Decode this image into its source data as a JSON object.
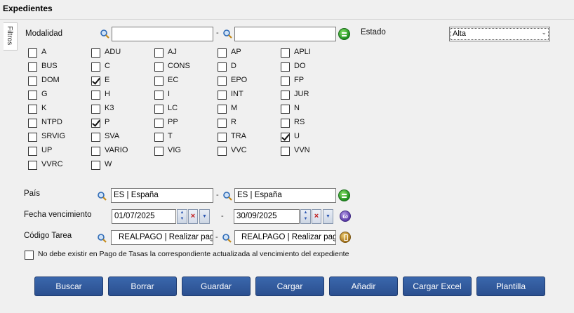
{
  "window": {
    "title": "Expedientes"
  },
  "sidebar": {
    "tab_label": "Filtros"
  },
  "filters": {
    "modalidad": {
      "label": "Modalidad",
      "from": "",
      "to": "",
      "separator": "-"
    },
    "estado": {
      "label": "Estado",
      "selected": "Alta"
    },
    "modalidades": [
      {
        "code": "A",
        "checked": false
      },
      {
        "code": "ADU",
        "checked": false
      },
      {
        "code": "AJ",
        "checked": false
      },
      {
        "code": "AP",
        "checked": false
      },
      {
        "code": "APLI",
        "checked": false
      },
      {
        "code": "BUS",
        "checked": false
      },
      {
        "code": "C",
        "checked": false
      },
      {
        "code": "CONS",
        "checked": false
      },
      {
        "code": "D",
        "checked": false
      },
      {
        "code": "DO",
        "checked": false
      },
      {
        "code": "DOM",
        "checked": false
      },
      {
        "code": "E",
        "checked": true
      },
      {
        "code": "EC",
        "checked": false
      },
      {
        "code": "EPO",
        "checked": false
      },
      {
        "code": "FP",
        "checked": false
      },
      {
        "code": "G",
        "checked": false
      },
      {
        "code": "H",
        "checked": false
      },
      {
        "code": "I",
        "checked": false
      },
      {
        "code": "INT",
        "checked": false
      },
      {
        "code": "JUR",
        "checked": false
      },
      {
        "code": "K",
        "checked": false
      },
      {
        "code": "K3",
        "checked": false
      },
      {
        "code": "LC",
        "checked": false
      },
      {
        "code": "M",
        "checked": false
      },
      {
        "code": "N",
        "checked": false
      },
      {
        "code": "NTPD",
        "checked": false
      },
      {
        "code": "P",
        "checked": true
      },
      {
        "code": "PP",
        "checked": false
      },
      {
        "code": "R",
        "checked": false
      },
      {
        "code": "RS",
        "checked": false
      },
      {
        "code": "SRVIG",
        "checked": false
      },
      {
        "code": "SVA",
        "checked": false
      },
      {
        "code": "T",
        "checked": false
      },
      {
        "code": "TRA",
        "checked": false
      },
      {
        "code": "U",
        "checked": true
      },
      {
        "code": "UP",
        "checked": false
      },
      {
        "code": "VARIO",
        "checked": false
      },
      {
        "code": "VIG",
        "checked": false
      },
      {
        "code": "VVC",
        "checked": false
      },
      {
        "code": "VVN",
        "checked": false
      },
      {
        "code": "VVRC",
        "checked": false
      },
      {
        "code": "W",
        "checked": false
      }
    ],
    "pais": {
      "label": "País",
      "from": "ES | España",
      "to": "ES | España",
      "separator": "-"
    },
    "fecha_vencimiento": {
      "label": "Fecha vencimiento",
      "from": "01/07/2025",
      "to": "30/09/2025",
      "separator": "-"
    },
    "codigo_tarea": {
      "label": "Código Tarea",
      "from": "REALPAGO | Realizar pago",
      "to": "REALPAGO | Realizar pago",
      "separator": "-"
    },
    "pago_tasas_check": {
      "label": "No debe existir en Pago de Tasas la correspondiente actualizada al vencimiento del expediente",
      "checked": false
    }
  },
  "actions": {
    "buscar": "Buscar",
    "borrar": "Borrar",
    "guardar": "Guardar",
    "cargar": "Cargar",
    "anadir": "Añadir",
    "cargar_excel": "Cargar Excel",
    "plantilla": "Plantilla"
  },
  "icons": {
    "search": "magnifier-icon",
    "add": "green-add-icon",
    "calendar_tool": "purple-calendar-icon",
    "task_tool": "gold-task-icon"
  },
  "colors": {
    "button_bg": "#2f5697",
    "accent_green": "#1e8f1e"
  }
}
